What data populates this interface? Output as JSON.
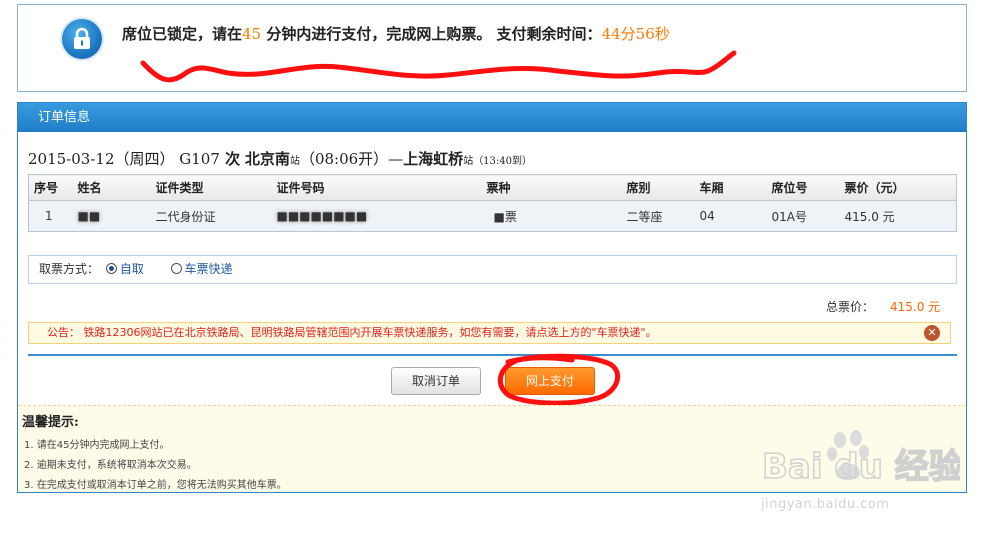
{
  "lock": {
    "msg_a": "席位已锁定，请在",
    "minutes": "45",
    "msg_b": " 分钟内进行支付，完成网上购票。 支付剩余时间：",
    "remaining": "44分56秒"
  },
  "panel": {
    "title": "订单信息"
  },
  "trip": {
    "date": "2015-03-12（周四）",
    "train": "G107",
    "train_suffix": " 次",
    "from": "北京南",
    "from_suffix": "站",
    "depart": "（08:06开）—",
    "to": "上海虹桥",
    "to_suffix": "站",
    "arrive": "（13:40到）"
  },
  "table": {
    "headers": [
      "序号",
      "姓名",
      "证件类型",
      "证件号码",
      "票种",
      "席别",
      "车厢",
      "席位号",
      "票价（元）"
    ],
    "rows": [
      [
        "1",
        "■■",
        "二代身份证",
        "■■■■■■■■",
        "■票",
        "二等座",
        "04",
        "01A号",
        "415.0 元"
      ]
    ]
  },
  "fetch": {
    "label": "取票方式：",
    "option_self": "自取",
    "option_express": "车票快递"
  },
  "total": {
    "label": "总票价：",
    "value": "415.0 元"
  },
  "notice": "公告： 铁路12306网站已在北京铁路局、昆明铁路局管辖范围内开展车票快递服务，如您有需要，请点选上方的\"车票快递\"。",
  "buttons": {
    "cancel": "取消订单",
    "pay": "网上支付"
  },
  "tips": {
    "title": "温馨提示:",
    "items": [
      "1.  请在45分钟内完成网上支付。",
      "2.  逾期未支付，系统将取消本次交易。",
      "3.  在完成支付或取消本订单之前，您将无法购买其他车票。"
    ]
  },
  "watermark": {
    "logo": "Bai du 经验",
    "url": "jingyan.baidu.com"
  },
  "colors": {
    "accent": "#1f7ec7",
    "orange": "#ff6a00",
    "notice_red": "#e02020"
  }
}
